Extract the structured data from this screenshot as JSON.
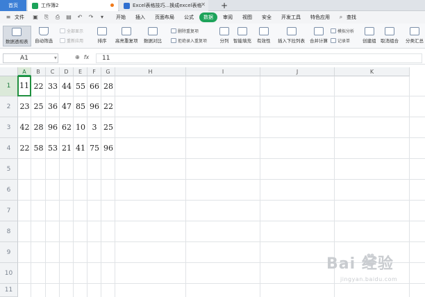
{
  "tabs": {
    "home": "首页",
    "workbook": "工作簿2",
    "doc": "Excel表格技巧...换成excel表格"
  },
  "menu": {
    "file": "文件",
    "items": [
      "开始",
      "插入",
      "页面布局",
      "公式",
      "数据",
      "审阅",
      "视图",
      "安全",
      "开发工具",
      "特色应用"
    ],
    "active_index": 4,
    "search": "查找"
  },
  "ribbon": {
    "pivot": "数据透视表",
    "autofilter": "自动筛选",
    "show_all": "全部显示",
    "reapply": "重新应用",
    "sort": "排序",
    "highlight_dup": "高亮重复项",
    "data_compare": "数据对比",
    "remove_dup": "删除重复项",
    "reject_dup": "拒绝录入重复项",
    "split": "分列",
    "smart_fill": "智能填充",
    "validity": "有效性",
    "insert_dropdown": "插入下拉列表",
    "consolidate": "合并计算",
    "simulation": "模拟分析",
    "record": "记录单",
    "create_group": "创建组",
    "ungroup": "取消组合",
    "subtotal": "分类汇总"
  },
  "formula_bar": {
    "name_box": "A1",
    "fx": "fx",
    "value": "11"
  },
  "sheet": {
    "columns": [
      "A",
      "B",
      "C",
      "D",
      "E",
      "F",
      "G",
      "H",
      "I",
      "J",
      "K"
    ],
    "rows": [
      "1",
      "2",
      "3",
      "4",
      "5",
      "6",
      "7",
      "8",
      "9",
      "10",
      "11"
    ],
    "data": [
      [
        "11",
        "22",
        "33",
        "44",
        "55",
        "66",
        "28"
      ],
      [
        "23",
        "25",
        "36",
        "47",
        "85",
        "96",
        "22"
      ],
      [
        "42",
        "28",
        "96",
        "62",
        "10",
        "3",
        "25"
      ],
      [
        "22",
        "58",
        "53",
        "21",
        "41",
        "75",
        "96"
      ]
    ],
    "selected_cell": "A1"
  },
  "watermark": {
    "main": "Bai 经验",
    "sub": "jingyan.baidu.com"
  }
}
